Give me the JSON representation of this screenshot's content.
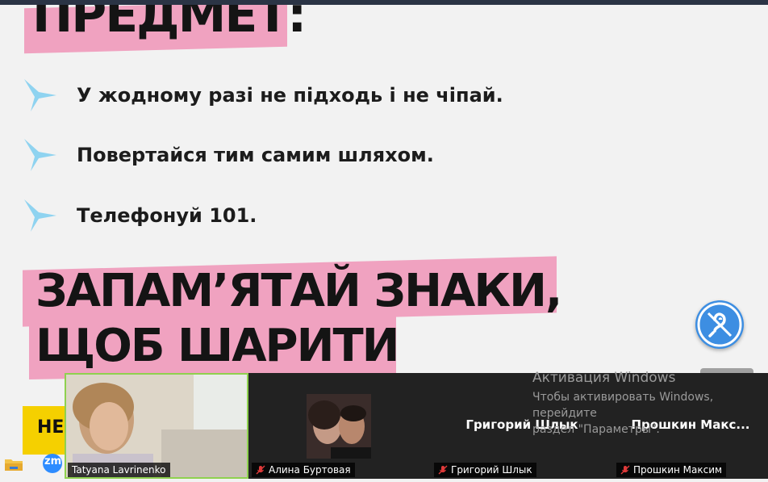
{
  "slide": {
    "heading_top": "ПРЕДМЕТ:",
    "bullets": [
      "У жодному разі не підходь і не чіпай.",
      "Повертайся тим самим шляхом.",
      "Телефонуй 101."
    ],
    "heading_line1": "ЗАПАМ’ЯТАЙ ЗНАКИ,",
    "heading_line2": "ЩОБ ШАРИТИ",
    "yellow_label": "НЕ",
    "accent_pink": "#f0a2c0",
    "star_color": "#8fd3f0"
  },
  "accessibility": {
    "icon": "hearing-accessibility-icon"
  },
  "gallery": {
    "participants": [
      {
        "name": "Tatyana Lavrinenko",
        "muted": false,
        "video": true
      },
      {
        "name": "Алина Буртовая",
        "muted": true,
        "video": true
      },
      {
        "name": "Григорий Шлык",
        "muted": true,
        "video": false,
        "display": "Григорий Шлык"
      },
      {
        "name": "Прошкин Максим",
        "muted": true,
        "video": false,
        "display": "Прошкин  Макс..."
      }
    ]
  },
  "windows_activation": {
    "title": "Активация Windows",
    "line1": "Чтобы активировать Windows, перейдите",
    "line2": "раздел \"Параметры\"."
  },
  "taskbar": {
    "zoom_label": "zm"
  }
}
